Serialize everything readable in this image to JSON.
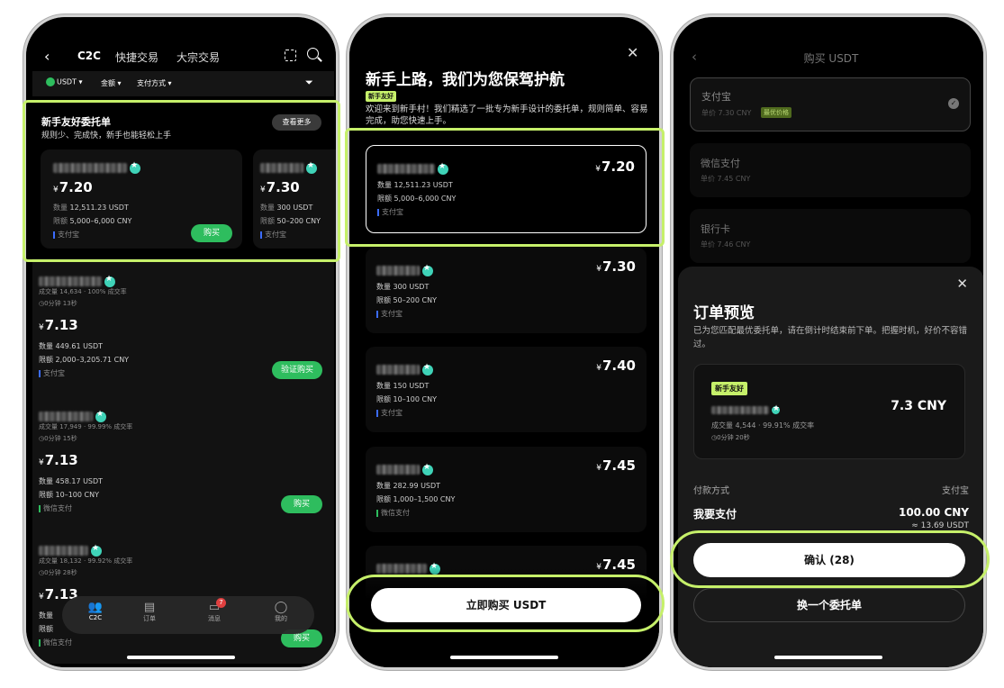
{
  "p1": {
    "nav": {
      "c2c": "C2C",
      "quick": "快捷交易",
      "bulk": "大宗交易"
    },
    "filters": {
      "coin": "USDT",
      "amount": "金额",
      "pay": "支付方式"
    },
    "beginner": {
      "title": "新手友好委托单",
      "subtitle": "规则少、完成快，新手也能轻松上手",
      "more": "查看更多"
    },
    "cards": [
      {
        "price": "7.20",
        "qty_label": "数量",
        "qty": "12,511.23 USDT",
        "limit_label": "限额",
        "limit": "5,000–6,000 CNY",
        "method": "支付宝",
        "buy": "购买"
      },
      {
        "price": "7.30",
        "qty_label": "数量",
        "qty": "300 USDT",
        "limit_label": "限额",
        "limit": "50–200 CNY",
        "method": "支付宝"
      }
    ],
    "list": [
      {
        "stats": "成交量 14,634 · 100% 成交率",
        "time": "0分钟 13秒",
        "price": "7.13",
        "qty": "数量 449.61 USDT",
        "limit": "限额 2,000–3,205.71 CNY",
        "method": "支付宝",
        "btn": "验证购买"
      },
      {
        "stats": "成交量 17,949 · 99.99% 成交率",
        "time": "0分钟 15秒",
        "price": "7.13",
        "qty": "数量 458.17 USDT",
        "limit": "限额 10–100 CNY",
        "method": "微信支付",
        "btn": "购买"
      },
      {
        "stats": "成交量 18,132 · 99.92% 成交率",
        "time": "0分钟 28秒",
        "price": "7.13",
        "qty": "数量",
        "limit": "限额",
        "method": "微信支付",
        "btn": "购买"
      }
    ],
    "tabbar": {
      "c2c": "C2C",
      "orders": "订单",
      "msg": "消息",
      "msg_badge": "7",
      "me": "我的"
    },
    "currency": "¥"
  },
  "p2": {
    "title": "新手上路，我们为您保驾护航",
    "badge": "新手友好",
    "desc": "欢迎来到新手村！我们精选了一批专为新手设计的委托单，规则简单、容易完成，助您快速上手。",
    "items": [
      {
        "price": "7.20",
        "qty": "数量 12,511.23 USDT",
        "limit": "限额 5,000–6,000 CNY",
        "method": "支付宝"
      },
      {
        "price": "7.30",
        "qty": "数量 300 USDT",
        "limit": "限额 50–200 CNY",
        "method": "支付宝"
      },
      {
        "price": "7.40",
        "qty": "数量 150 USDT",
        "limit": "限额 10–100 CNY",
        "method": "支付宝"
      },
      {
        "price": "7.45",
        "qty": "数量 282.99 USDT",
        "limit": "限额 1,000–1,500 CNY",
        "method": "微信支付"
      },
      {
        "price": "7.45"
      }
    ],
    "buy_btn": "立即购买 USDT"
  },
  "p3": {
    "title": "购买 USDT",
    "methods": [
      {
        "name": "支付宝",
        "price": "单价 7.30 CNY",
        "tag": "最优价格"
      },
      {
        "name": "微信支付",
        "price": "单价 7.45 CNY"
      },
      {
        "name": "银行卡",
        "price": "单价 7.46 CNY"
      }
    ],
    "sheet": {
      "title": "订单预览",
      "desc": "已为您匹配最优委托单，请在倒计时结束前下单。把握时机，好价不容错过。",
      "badge": "新手友好",
      "price": "7.3 CNY",
      "stats": "成交量 4,544 · 99.91% 成交率",
      "time": "0分钟 20秒",
      "pay_label": "付款方式",
      "pay_value": "支付宝",
      "amount_label": "我要支付",
      "amount": "100.00 CNY",
      "approx": "≈ 13.69 USDT",
      "confirm": "确认 (28)",
      "switch": "换一个委托单"
    }
  }
}
